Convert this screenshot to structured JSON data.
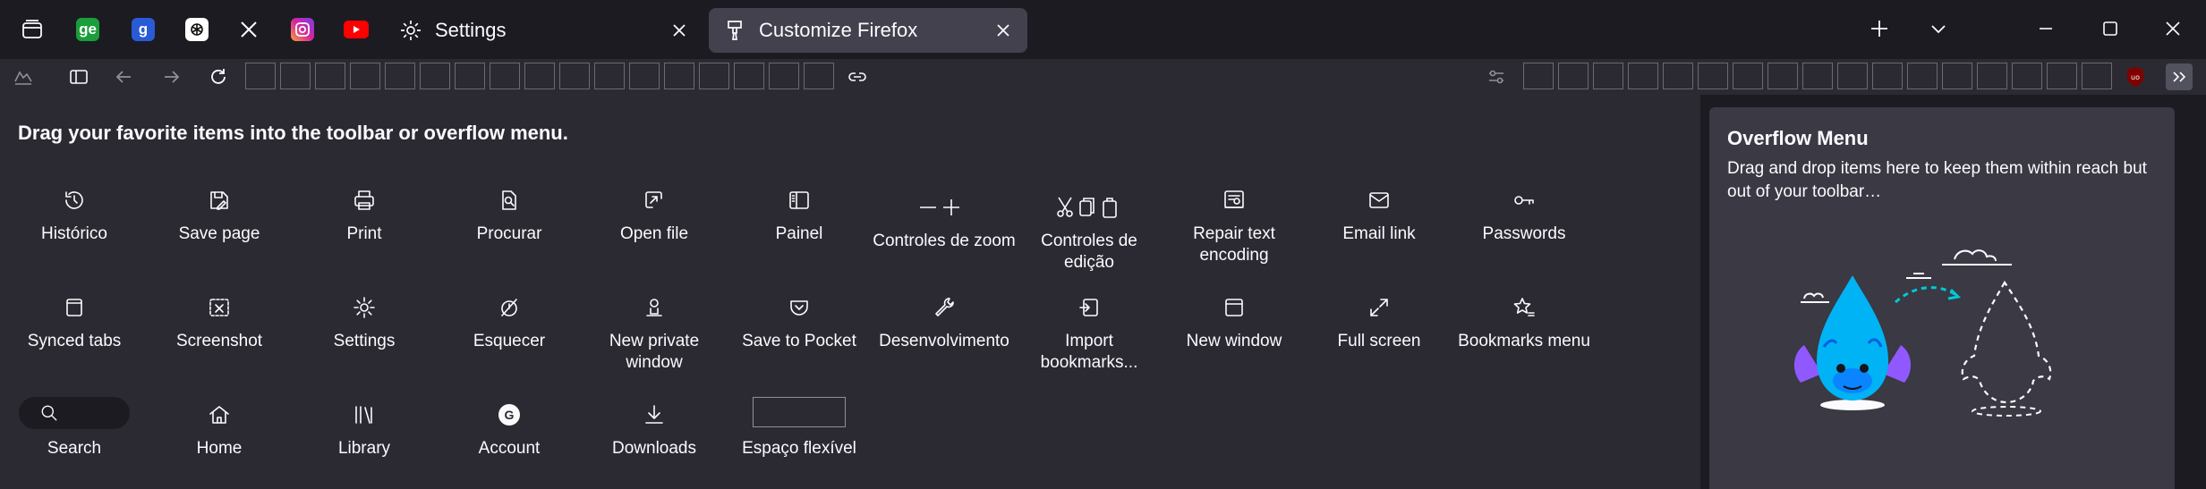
{
  "browser": {
    "pinned_tabs": [
      {
        "name": "tab-manager",
        "glyph": ""
      },
      {
        "name": "ge",
        "glyph": "ge",
        "color": "#1a9e3a"
      },
      {
        "name": "g",
        "glyph": "g",
        "color": "#2a5bd7"
      },
      {
        "name": "chatgpt",
        "glyph": "",
        "color": "#ffffff"
      },
      {
        "name": "x",
        "glyph": "X"
      },
      {
        "name": "instagram",
        "glyph": "",
        "color": "#d6249f"
      },
      {
        "name": "youtube",
        "glyph": "",
        "color": "#ff0000"
      }
    ],
    "tabs": [
      {
        "title": "Settings",
        "active": false
      },
      {
        "title": "Customize Firefox",
        "active": true
      }
    ]
  },
  "palette": {
    "heading": "Drag your favorite items into the toolbar or overflow menu.",
    "row1": [
      {
        "label": "Histórico",
        "icon": "history-icon"
      },
      {
        "label": "Save page",
        "icon": "save-page-icon"
      },
      {
        "label": "Print",
        "icon": "print-icon"
      },
      {
        "label": "Procurar",
        "icon": "find-icon"
      },
      {
        "label": "Open file",
        "icon": "open-file-icon"
      },
      {
        "label": "Painel",
        "icon": "sidebar-icon"
      },
      {
        "label": "Controles de zoom",
        "icon": "zoom-controls-icon"
      },
      {
        "label": "Controles de edição",
        "icon": "edit-controls-icon"
      },
      {
        "label": "Repair text encoding",
        "icon": "text-encoding-icon"
      },
      {
        "label": "Email link",
        "icon": "email-icon"
      },
      {
        "label": "Passwords",
        "icon": "key-icon"
      }
    ],
    "row2": [
      {
        "label": "Synced tabs",
        "icon": "synced-tabs-icon"
      },
      {
        "label": "Screenshot",
        "icon": "screenshot-icon"
      },
      {
        "label": "Settings",
        "icon": "gear-icon"
      },
      {
        "label": "Esquecer",
        "icon": "forget-icon"
      },
      {
        "label": "New private window",
        "icon": "private-window-icon"
      },
      {
        "label": "Save to Pocket",
        "icon": "pocket-icon"
      },
      {
        "label": "Desenvolvimento",
        "icon": "wrench-icon"
      },
      {
        "label": "Import bookmarks...",
        "icon": "import-icon"
      },
      {
        "label": "New window",
        "icon": "new-window-icon"
      },
      {
        "label": "Full screen",
        "icon": "fullscreen-icon"
      },
      {
        "label": "Bookmarks menu",
        "icon": "bookmarks-menu-icon"
      }
    ],
    "row3": [
      {
        "label": "Search",
        "icon": "search-icon"
      },
      {
        "label": "Home",
        "icon": "home-icon"
      },
      {
        "label": "Library",
        "icon": "library-icon"
      },
      {
        "label": "Account",
        "icon": "account-icon"
      },
      {
        "label": "Downloads",
        "icon": "download-icon"
      },
      {
        "label": "Espaço flexível",
        "icon": "flexible-space"
      }
    ]
  },
  "overflow": {
    "title": "Overflow Menu",
    "description": "Drag and drop items here to keep them within reach but out of your toolbar…"
  }
}
